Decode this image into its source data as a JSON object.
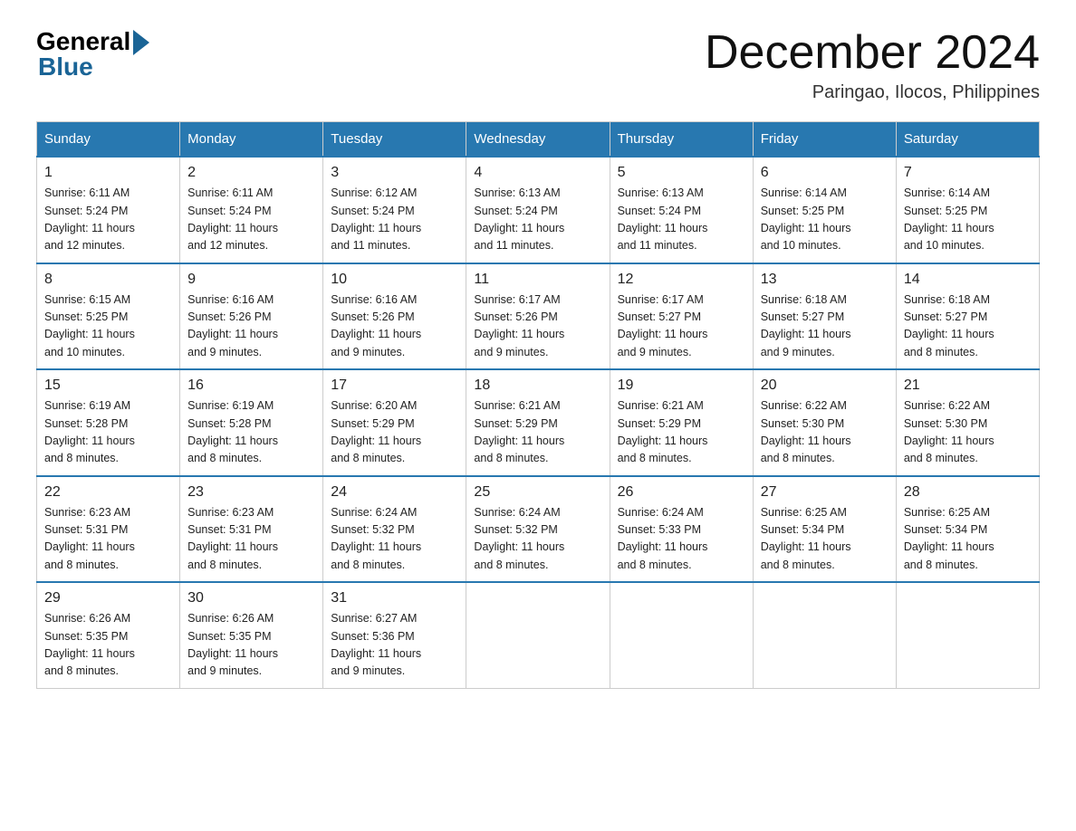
{
  "logo": {
    "general": "General",
    "blue": "Blue"
  },
  "title": "December 2024",
  "location": "Paringao, Ilocos, Philippines",
  "days_of_week": [
    "Sunday",
    "Monday",
    "Tuesday",
    "Wednesday",
    "Thursday",
    "Friday",
    "Saturday"
  ],
  "weeks": [
    [
      {
        "day": "1",
        "sunrise": "6:11 AM",
        "sunset": "5:24 PM",
        "daylight": "11 hours and 12 minutes."
      },
      {
        "day": "2",
        "sunrise": "6:11 AM",
        "sunset": "5:24 PM",
        "daylight": "11 hours and 12 minutes."
      },
      {
        "day": "3",
        "sunrise": "6:12 AM",
        "sunset": "5:24 PM",
        "daylight": "11 hours and 11 minutes."
      },
      {
        "day": "4",
        "sunrise": "6:13 AM",
        "sunset": "5:24 PM",
        "daylight": "11 hours and 11 minutes."
      },
      {
        "day": "5",
        "sunrise": "6:13 AM",
        "sunset": "5:24 PM",
        "daylight": "11 hours and 11 minutes."
      },
      {
        "day": "6",
        "sunrise": "6:14 AM",
        "sunset": "5:25 PM",
        "daylight": "11 hours and 10 minutes."
      },
      {
        "day": "7",
        "sunrise": "6:14 AM",
        "sunset": "5:25 PM",
        "daylight": "11 hours and 10 minutes."
      }
    ],
    [
      {
        "day": "8",
        "sunrise": "6:15 AM",
        "sunset": "5:25 PM",
        "daylight": "11 hours and 10 minutes."
      },
      {
        "day": "9",
        "sunrise": "6:16 AM",
        "sunset": "5:26 PM",
        "daylight": "11 hours and 9 minutes."
      },
      {
        "day": "10",
        "sunrise": "6:16 AM",
        "sunset": "5:26 PM",
        "daylight": "11 hours and 9 minutes."
      },
      {
        "day": "11",
        "sunrise": "6:17 AM",
        "sunset": "5:26 PM",
        "daylight": "11 hours and 9 minutes."
      },
      {
        "day": "12",
        "sunrise": "6:17 AM",
        "sunset": "5:27 PM",
        "daylight": "11 hours and 9 minutes."
      },
      {
        "day": "13",
        "sunrise": "6:18 AM",
        "sunset": "5:27 PM",
        "daylight": "11 hours and 9 minutes."
      },
      {
        "day": "14",
        "sunrise": "6:18 AM",
        "sunset": "5:27 PM",
        "daylight": "11 hours and 8 minutes."
      }
    ],
    [
      {
        "day": "15",
        "sunrise": "6:19 AM",
        "sunset": "5:28 PM",
        "daylight": "11 hours and 8 minutes."
      },
      {
        "day": "16",
        "sunrise": "6:19 AM",
        "sunset": "5:28 PM",
        "daylight": "11 hours and 8 minutes."
      },
      {
        "day": "17",
        "sunrise": "6:20 AM",
        "sunset": "5:29 PM",
        "daylight": "11 hours and 8 minutes."
      },
      {
        "day": "18",
        "sunrise": "6:21 AM",
        "sunset": "5:29 PM",
        "daylight": "11 hours and 8 minutes."
      },
      {
        "day": "19",
        "sunrise": "6:21 AM",
        "sunset": "5:29 PM",
        "daylight": "11 hours and 8 minutes."
      },
      {
        "day": "20",
        "sunrise": "6:22 AM",
        "sunset": "5:30 PM",
        "daylight": "11 hours and 8 minutes."
      },
      {
        "day": "21",
        "sunrise": "6:22 AM",
        "sunset": "5:30 PM",
        "daylight": "11 hours and 8 minutes."
      }
    ],
    [
      {
        "day": "22",
        "sunrise": "6:23 AM",
        "sunset": "5:31 PM",
        "daylight": "11 hours and 8 minutes."
      },
      {
        "day": "23",
        "sunrise": "6:23 AM",
        "sunset": "5:31 PM",
        "daylight": "11 hours and 8 minutes."
      },
      {
        "day": "24",
        "sunrise": "6:24 AM",
        "sunset": "5:32 PM",
        "daylight": "11 hours and 8 minutes."
      },
      {
        "day": "25",
        "sunrise": "6:24 AM",
        "sunset": "5:32 PM",
        "daylight": "11 hours and 8 minutes."
      },
      {
        "day": "26",
        "sunrise": "6:24 AM",
        "sunset": "5:33 PM",
        "daylight": "11 hours and 8 minutes."
      },
      {
        "day": "27",
        "sunrise": "6:25 AM",
        "sunset": "5:34 PM",
        "daylight": "11 hours and 8 minutes."
      },
      {
        "day": "28",
        "sunrise": "6:25 AM",
        "sunset": "5:34 PM",
        "daylight": "11 hours and 8 minutes."
      }
    ],
    [
      {
        "day": "29",
        "sunrise": "6:26 AM",
        "sunset": "5:35 PM",
        "daylight": "11 hours and 8 minutes."
      },
      {
        "day": "30",
        "sunrise": "6:26 AM",
        "sunset": "5:35 PM",
        "daylight": "11 hours and 9 minutes."
      },
      {
        "day": "31",
        "sunrise": "6:27 AM",
        "sunset": "5:36 PM",
        "daylight": "11 hours and 9 minutes."
      },
      null,
      null,
      null,
      null
    ]
  ],
  "labels": {
    "sunrise": "Sunrise:",
    "sunset": "Sunset:",
    "daylight": "Daylight:"
  }
}
